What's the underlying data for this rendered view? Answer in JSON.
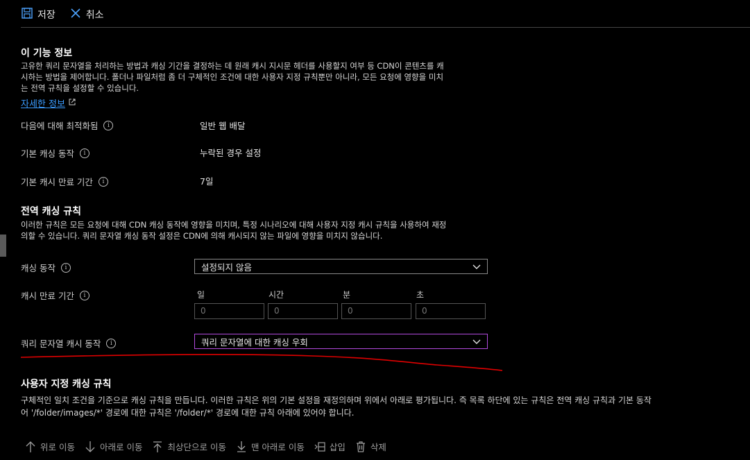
{
  "toolbar": {
    "save_label": "저장",
    "cancel_label": "취소"
  },
  "about": {
    "title": "이 기능 정보",
    "description_lines": [
      "고유한 쿼리 문자열을 처리하는 방법과 캐싱 기간을 결정하는 데 원래 캐시 지시문 헤더를 사용할지 여부 등 CDN이 콘텐츠를 캐",
      "시하는 방법을 제어합니다. 폴더나 파일처럼 좀 더 구체적인 조건에 대한 사용자 지정 규칙뿐만 아니라, 모든 요청에 영향을 미치",
      "는 전역 규칙을 설정할 수 있습니다."
    ],
    "learn_more": "자세한 정보"
  },
  "settings": {
    "optimized_for": {
      "label": "다음에 대해 최적화됨",
      "value": "일반 웹 배달"
    },
    "default_caching": {
      "label": "기본 캐싱 동작",
      "value": "누락된 경우 설정"
    },
    "default_expiration": {
      "label": "기본 캐시 만료 기간",
      "value": "7일"
    }
  },
  "global_rules": {
    "title": "전역 캐싱 규칙",
    "description_lines": [
      "이러한 규칙은 모든 요청에 대해 CDN 캐싱 동작에 영향을 미치며, 특정 시나리오에 대해 사용자 지정 캐시 규칙을 사용하여 재정",
      "의할 수 있습니다. 쿼리 문자열 캐싱 동작 설정은 CDN에 의해 캐시되지 않는 파일에 영향을 미치지 않습니다."
    ],
    "caching_behavior": {
      "label": "캐싱 동작",
      "value": "설정되지 않음"
    },
    "cache_expiration": {
      "label": "캐시 만료 기간",
      "fields": [
        {
          "label": "일",
          "value": "0"
        },
        {
          "label": "시간",
          "value": "0"
        },
        {
          "label": "분",
          "value": "0"
        },
        {
          "label": "초",
          "value": "0"
        }
      ]
    },
    "query_string": {
      "label": "쿼리 문자열 캐시 동작",
      "value": "쿼리 문자열에 대한 캐싱 우회"
    }
  },
  "custom_rules": {
    "title": "사용자 지정 캐싱 규칙",
    "description_lines": [
      "구체적인 일치 조건을 기준으로 캐싱 규칙을 만듭니다. 이러한 규칙은 위의 기본 설정을 재정의하며 위에서 아래로 평가됩니다. 즉 목록 하단에 있는 규칙은 전역 캐싱 규칙과 기본 동작",
      "어 '/folder/images/*' 경로에 대한 규칙은 '/folder/*' 경로에 대한 규칙 아래에 있어야 합니다."
    ]
  },
  "commands": {
    "move_up": "위로 이동",
    "move_down": "아래로 이동",
    "move_top": "최상단으로 이동",
    "move_bottom": "맨 아래로 이동",
    "insert": "삽입",
    "delete": "삭제"
  },
  "colors": {
    "link": "#3b9cff",
    "annotation": "#e00000",
    "focus_border": "#b44be1"
  }
}
